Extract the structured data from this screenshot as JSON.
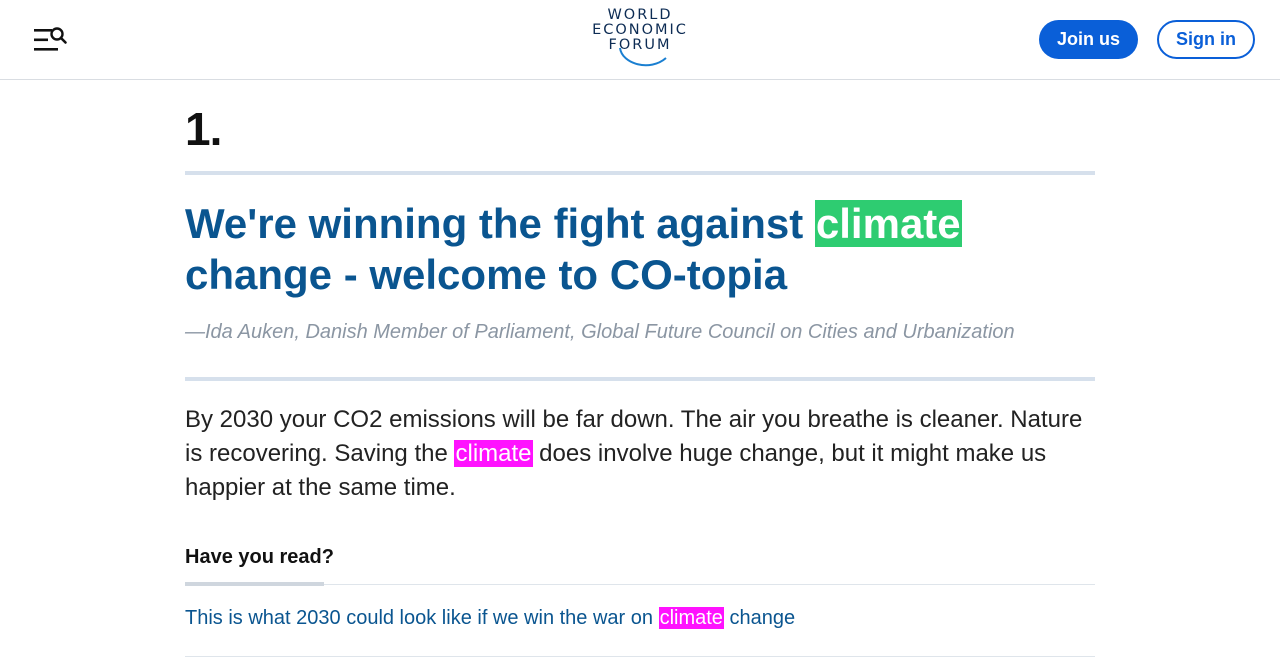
{
  "header": {
    "logo": {
      "line1": "WORLD",
      "line2": "ECONOMIC",
      "line3": "FORUM"
    },
    "menu_icon": "menu-search-icon",
    "join_label": "Join us",
    "sign_label": "Sign in"
  },
  "article": {
    "number": "1.",
    "quote": {
      "before": "We're winning the fight against ",
      "highlight": "climate",
      "after": " change - welcome to CO-topia"
    },
    "attribution": "—Ida Auken, Danish Member of Parliament, Global Future Council on Cities and Urbanization",
    "body": {
      "before": "By 2030 your CO2 emissions will be far down. The air you breathe is cleaner. Nature is recovering. Saving the ",
      "highlight": "climate",
      "after": " does involve huge change, but it might make us happier at the same time."
    }
  },
  "related": {
    "heading": "Have you read?",
    "link": {
      "before": "This is what 2030 could look like if we win the war on ",
      "highlight": "climate",
      "after": " change"
    }
  },
  "colors": {
    "accent": "#0a5fd8",
    "headline": "#0a5590",
    "highlight_green": "#2ecc71",
    "highlight_pink": "#ff12ff"
  }
}
